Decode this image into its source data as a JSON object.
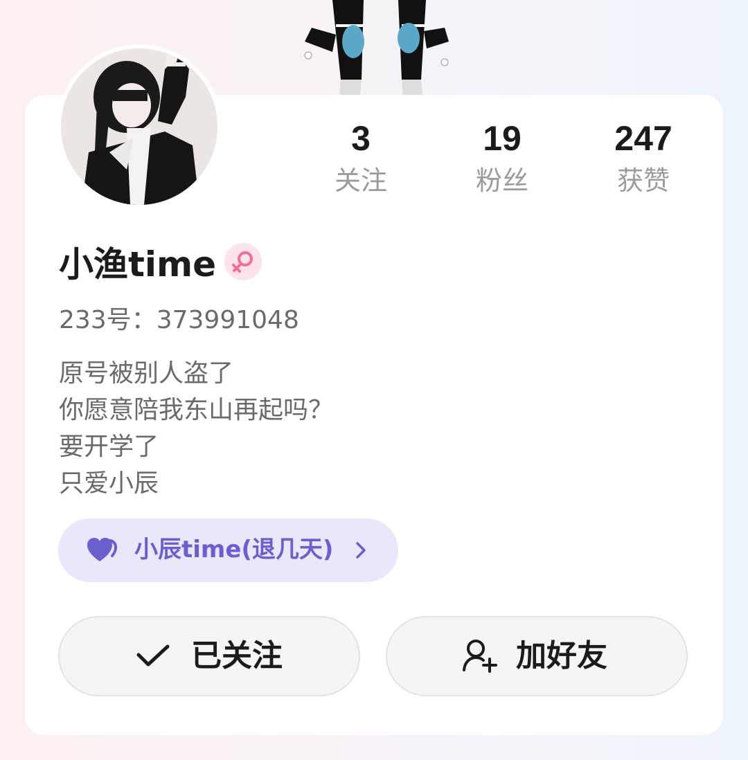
{
  "stats": [
    {
      "value": "3",
      "label": "关注"
    },
    {
      "value": "19",
      "label": "粉丝"
    },
    {
      "value": "247",
      "label": "获赞"
    }
  ],
  "profile": {
    "name": "小渔time",
    "gender_icon": "female-icon",
    "id_text": "233号：373991048",
    "bio_lines": [
      "原号被别人盗了",
      "你愿意陪我东山再起吗？",
      "要开学了",
      "只爱小辰"
    ]
  },
  "partner": {
    "label": "小辰time(退几天)",
    "icon": "heart-icon",
    "color": "#6a5fcf"
  },
  "actions": {
    "follow_label": "已关注",
    "add_friend_label": "加好友"
  },
  "colors": {
    "gender_pink": "#f26e96",
    "partner_bg": "#e8e7fb"
  }
}
